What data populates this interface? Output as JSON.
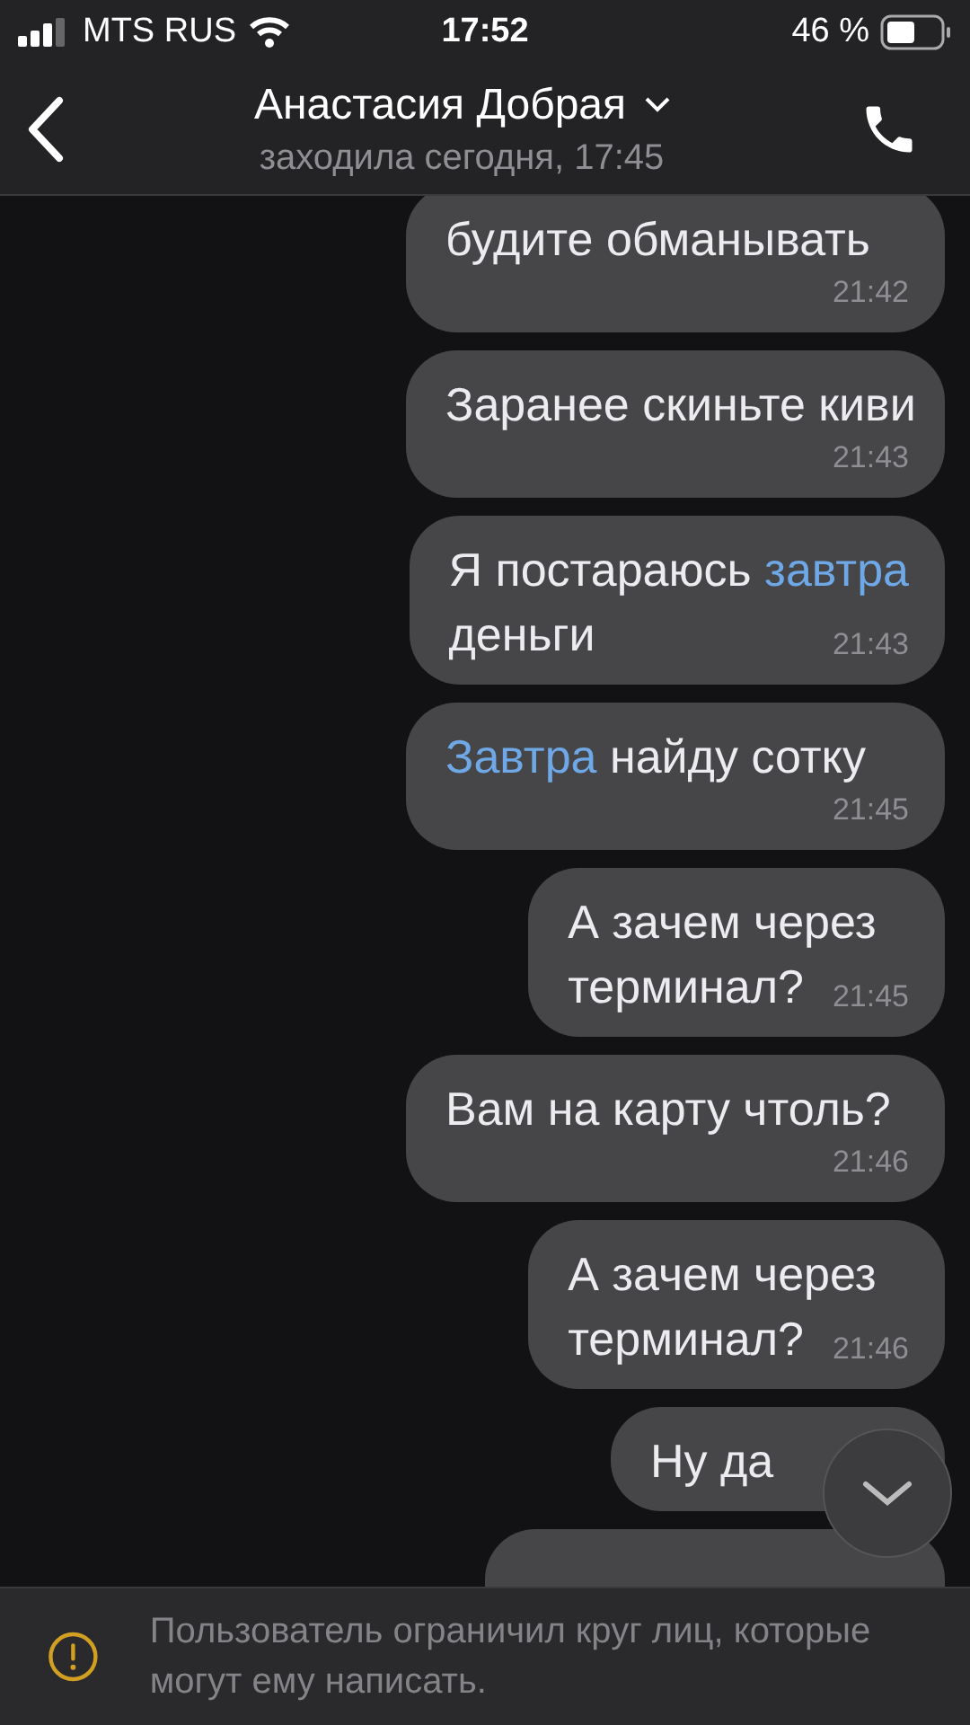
{
  "status_bar": {
    "carrier": "MTS RUS",
    "time": "17:52",
    "battery": "46 %"
  },
  "header": {
    "name": "Анастасия Добрая",
    "status": "заходила сегодня, 17:45"
  },
  "messages": [
    {
      "lines": [
        [
          {
            "text": "будите обманывать"
          }
        ]
      ],
      "time": "21:42"
    },
    {
      "lines": [
        [
          {
            "text": "Заранее скиньте киви"
          }
        ]
      ],
      "time": "21:43"
    },
    {
      "lines": [
        [
          {
            "text": "Я постараюсь "
          },
          {
            "text": "завтра",
            "link": true
          }
        ],
        [
          {
            "text": "деньги"
          }
        ]
      ],
      "time": "21:43"
    },
    {
      "lines": [
        [
          {
            "text": "Завтра",
            "link": true
          },
          {
            "text": " найду сотку"
          }
        ]
      ],
      "time": "21:45"
    },
    {
      "lines": [
        [
          {
            "text": "А зачем через"
          }
        ],
        [
          {
            "text": "терминал?"
          }
        ]
      ],
      "time": "21:45"
    },
    {
      "lines": [
        [
          {
            "text": "Вам на карту чтоль?"
          }
        ]
      ],
      "time": "21:46"
    },
    {
      "lines": [
        [
          {
            "text": "А зачем через"
          }
        ],
        [
          {
            "text": "терминал?"
          }
        ]
      ],
      "time": "21:46"
    },
    {
      "lines": [
        [
          {
            "text": "Ну да"
          }
        ]
      ]
    },
    {
      "kind": "cut"
    }
  ],
  "notice": {
    "text": "Пользователь ограничил круг лиц, которые могут ему написать."
  }
}
